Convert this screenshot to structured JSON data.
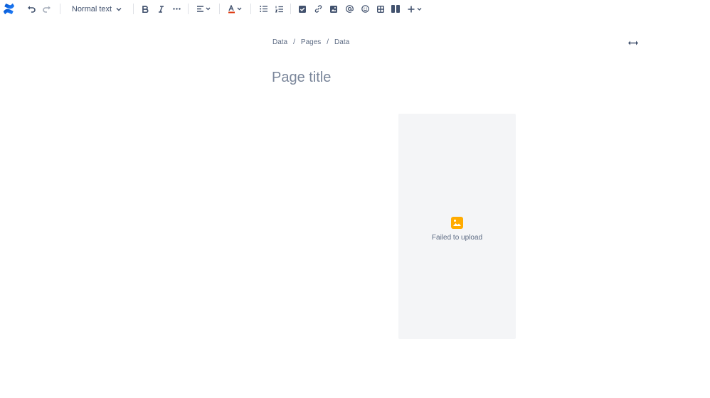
{
  "toolbar": {
    "text_style": "Normal text",
    "accent_color": "#0052cc",
    "icons": [
      "confluence-logo",
      "undo-icon",
      "redo-icon",
      "bold-icon",
      "italic-icon",
      "more-formatting-icon",
      "align-icon",
      "text-color-icon",
      "bullet-list-icon",
      "numbered-list-icon",
      "action-item-icon",
      "link-icon",
      "image-icon",
      "mention-icon",
      "emoji-icon",
      "table-icon",
      "layouts-icon",
      "insert-plus-icon"
    ]
  },
  "breadcrumb": {
    "items": [
      "Data",
      "Pages",
      "Data"
    ],
    "separator": "/"
  },
  "page": {
    "title_placeholder": "Page title"
  },
  "media": {
    "error_text": "Failed to upload",
    "error_color": "#ffab00"
  }
}
